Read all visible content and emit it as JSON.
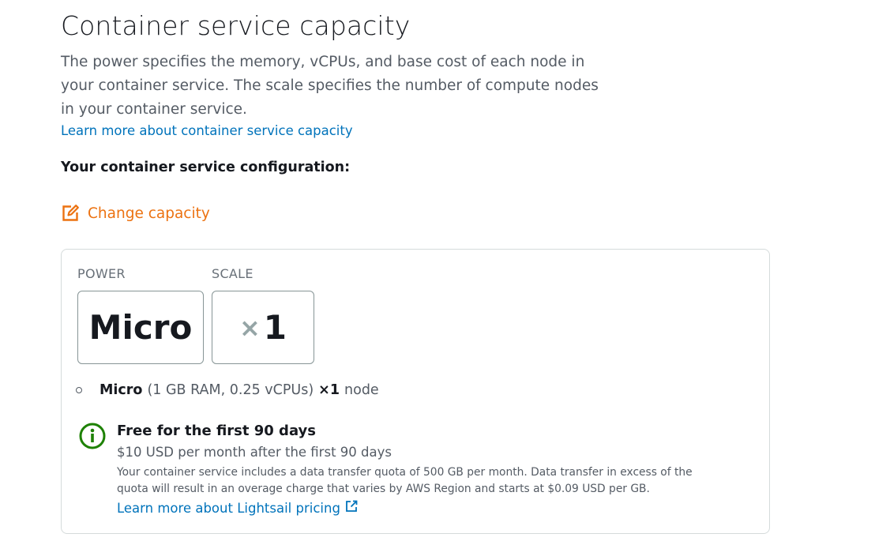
{
  "section": {
    "title": "Container service capacity",
    "description": "The power specifies the memory, vCPUs, and base cost of each node in your container service. The scale specifies the number of compute nodes in your container service.",
    "learn_more_link": "Learn more about container service capacity",
    "config_heading": "Your container service configuration:",
    "change_capacity_label": "Change capacity"
  },
  "capacity": {
    "power_label": "POWER",
    "scale_label": "SCALE",
    "power_value": "Micro",
    "scale_multiplier": "×",
    "scale_value": "1"
  },
  "summary": {
    "power_name": "Micro",
    "specs": "(1 GB RAM, 0.25 vCPUs)",
    "scale": "×1",
    "unit": "node"
  },
  "pricing": {
    "free_title": "Free for the first 90 days",
    "after_price": "$10 USD per month after the first 90 days",
    "note": "Your container service includes a data transfer quota of 500 GB per month. Data transfer in excess of the quota will result in an overage charge that varies by AWS Region and starts at $0.09 USD per GB.",
    "learn_more_link": "Learn more about Lightsail pricing"
  },
  "icons": {
    "edit": "edit-icon",
    "info": "info-icon",
    "external_link": "external-link-icon"
  },
  "colors": {
    "link": "#0073bb",
    "action": "#ec7211",
    "success": "#1d8102",
    "text": "#16191f",
    "muted": "#545b64"
  }
}
